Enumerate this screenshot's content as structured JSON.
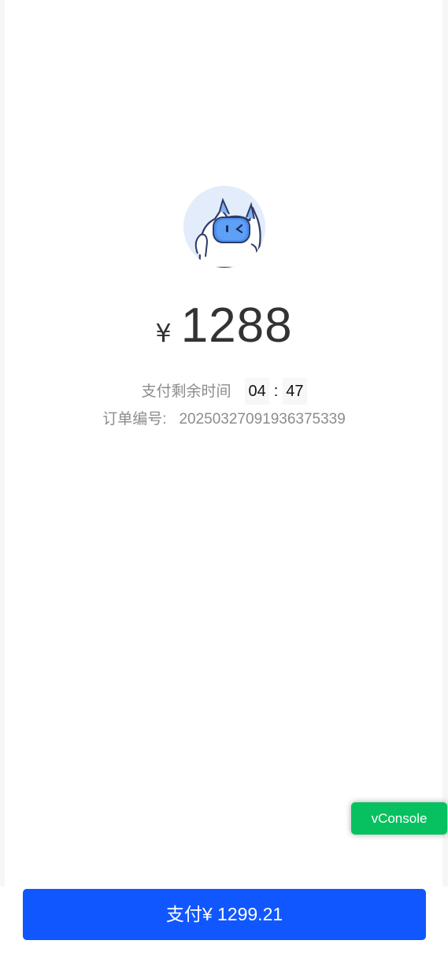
{
  "header": {
    "avatar_icon": "robot-mascot-icon"
  },
  "payment": {
    "currency_symbol": "¥",
    "amount": "1288"
  },
  "countdown": {
    "label": "支付剩余时间",
    "minutes": "04",
    "separator": ":",
    "seconds": "47"
  },
  "order": {
    "label": "订单编号:",
    "number": "20250327091936375339"
  },
  "debug": {
    "vconsole_label": "vConsole",
    "vconsole_color": "#07c160"
  },
  "footer": {
    "pay_button_label": "支付¥ 1299.21",
    "pay_button_color": "#1157ff"
  }
}
